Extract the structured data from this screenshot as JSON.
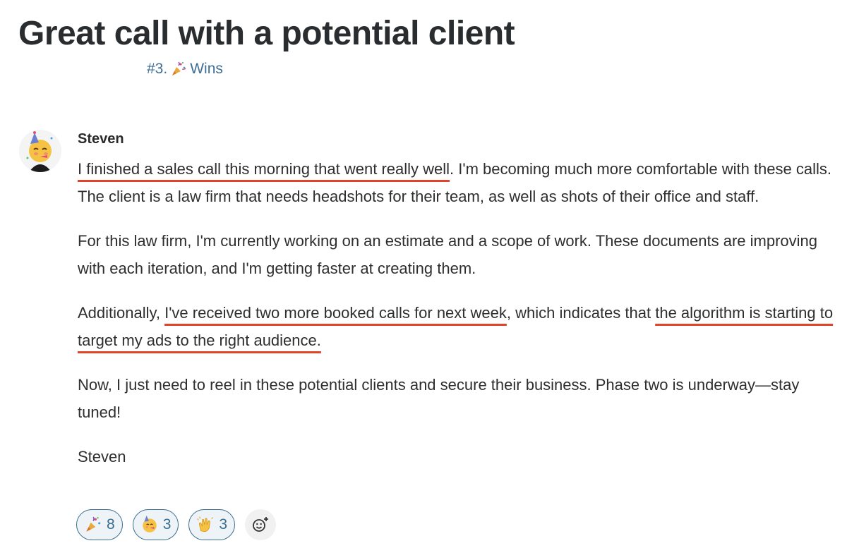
{
  "post": {
    "title": "Great call with a potential client",
    "category_number": "#3.",
    "category_name": "Wins"
  },
  "comment": {
    "author": "Steven",
    "p1_u": "I finished a sales call this morning that went really well",
    "p1_rest": ". I'm becoming much more comfortable with these calls. The client is a law firm that needs headshots for their team, as well as shots of their office and staff.",
    "p2": "For this law firm, I'm currently working on an estimate and a scope of work. These documents are improving with each iteration, and I'm getting faster at creating them.",
    "p3_a": "Additionally, ",
    "p3_u1": "I've received two more booked calls for next week",
    "p3_b": ", which indicates that ",
    "p3_u2": "the algorithm is starting to target my ads to the right audience.",
    "p4": "Now, I just need to reel in these potential clients and secure their business. Phase two is underway—stay tuned!",
    "signature": "Steven"
  },
  "reactions": [
    {
      "icon": "party-popper-icon",
      "count": "8"
    },
    {
      "icon": "partying-face-icon",
      "count": "3"
    },
    {
      "icon": "clapping-hands-icon",
      "count": "3"
    }
  ],
  "colors": {
    "underline": "#e0442a",
    "link": "#3f6f96",
    "reaction_border": "#3b6d8f"
  }
}
